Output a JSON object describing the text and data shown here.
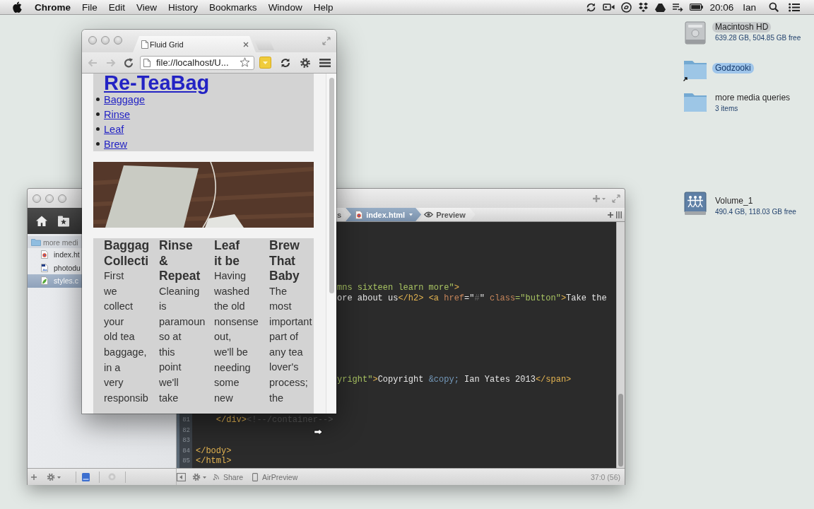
{
  "menu_bar": {
    "app_name": "Chrome",
    "menus": [
      "File",
      "Edit",
      "View",
      "History",
      "Bookmarks",
      "Window",
      "Help"
    ],
    "clock": "20:06",
    "user": "Ian"
  },
  "desktop_items": [
    {
      "kind": "drive",
      "name": "Macintosh HD",
      "info": "639.28 GB, 504.85 GB free",
      "selected": false,
      "color": "#c6cacb"
    },
    {
      "kind": "alias-folder",
      "name": "Godzooki",
      "selected": true
    },
    {
      "kind": "folder",
      "name": "more media queries",
      "info": "3 items",
      "selected": false
    },
    {
      "kind": "network-drive",
      "name": "Volume_1",
      "info": "490.4 GB, 118.03 GB free",
      "selected": false
    }
  ],
  "editor": {
    "sidebar": {
      "folder": "more medi",
      "files": [
        {
          "kind": "html",
          "name": "index.ht",
          "selected": false
        },
        {
          "kind": "image",
          "name": "photodu",
          "selected": false
        },
        {
          "kind": "css",
          "name": "styles.c",
          "selected": true
        }
      ]
    },
    "tabs": [
      {
        "kind": "crumb",
        "label": "s",
        "selected": false
      },
      {
        "kind": "file",
        "label": "index.html",
        "selected": true
      },
      {
        "kind": "preview",
        "label": "Preview",
        "selected": false
      }
    ],
    "lines": [
      {
        "kind": "blank"
      },
      {
        "kind": "blank"
      },
      {
        "kind": "blank"
      },
      {
        "kind": "blank"
      },
      {
        "kind": "blank"
      },
      {
        "kind": "blank"
      },
      {
        "kind": "clipped",
        "tokens": [
          {
            "text": "mns sixteen learn more\"",
            "kind": "string"
          },
          {
            "text": ">",
            "kind": "tag"
          }
        ]
      },
      {
        "kind": "clipped",
        "tokens": [
          {
            "text": "ore about us",
            "kind": "text"
          },
          {
            "text": "</h2>",
            "kind": "tag"
          },
          {
            "text": " <a",
            "kind": "tag"
          },
          {
            "text": " href",
            "kind": "attr"
          },
          {
            "text": "=\"",
            "kind": "text"
          },
          {
            "text": "#",
            "kind": "muted"
          },
          {
            "text": "\"",
            "kind": "text"
          },
          {
            "text": " class",
            "kind": "attr"
          },
          {
            "text": "=\"button\"",
            "kind": "string"
          },
          {
            "text": ">",
            "kind": "tag"
          },
          {
            "text": "Take the",
            "kind": "text"
          }
        ]
      },
      {
        "kind": "blank"
      },
      {
        "kind": "blank"
      },
      {
        "kind": "blank"
      },
      {
        "kind": "blank"
      },
      {
        "kind": "blank"
      },
      {
        "kind": "blank"
      },
      {
        "kind": "blank"
      },
      {
        "kind": "clipped",
        "tokens": [
          {
            "text": "yright\"",
            "kind": "string"
          },
          {
            "text": ">",
            "kind": "tag"
          },
          {
            "text": "Copyright ",
            "kind": "text"
          },
          {
            "text": "&copy;",
            "kind": "entity"
          },
          {
            "text": " Ian Yates 2013",
            "kind": "text"
          },
          {
            "text": "</span>",
            "kind": "tag"
          }
        ]
      },
      {
        "kind": "blank"
      },
      {
        "kind": "blank"
      },
      {
        "kind": "blank"
      },
      {
        "kind": "indented",
        "number": "81",
        "tokens": [
          {
            "text": "</div>",
            "kind": "tag"
          },
          {
            "text": "<!--/container-->",
            "kind": "comment"
          }
        ]
      },
      {
        "kind": "blank",
        "number": "82"
      },
      {
        "kind": "blank",
        "number": "83"
      },
      {
        "kind": "code",
        "number": "84",
        "tokens": [
          {
            "text": "</body>",
            "kind": "tag"
          }
        ]
      },
      {
        "kind": "code",
        "number": "85",
        "tokens": [
          {
            "text": "</html>",
            "kind": "tag"
          }
        ]
      }
    ],
    "status": {
      "share": "Share",
      "preview": "AirPreview",
      "position": "37:0 (56)"
    }
  },
  "browser": {
    "tab_title": "Fluid Grid",
    "nav_buttons": [
      {
        "kind": "back",
        "disabled": true
      },
      {
        "kind": "forward",
        "disabled": true
      }
    ],
    "address": "file://localhost/U...",
    "page": {
      "title": "Re-TeaBag",
      "nav": [
        "Baggage",
        "Rinse",
        "Leaf",
        "Brew"
      ],
      "columns": [
        {
          "heading": "Baggag Collecti",
          "text": "First we collect your old tea baggage, in a very responsib"
        },
        {
          "heading": "Rinse & Repeat",
          "text": "Cleaning is paramoun so at this point we'll take"
        },
        {
          "heading": "Leaf it be",
          "text": "Having washed the old nonsense out, we'll be needing some new"
        },
        {
          "heading": "Brew That Baby",
          "text": "The most important part of any tea lover's process; the"
        }
      ]
    }
  }
}
